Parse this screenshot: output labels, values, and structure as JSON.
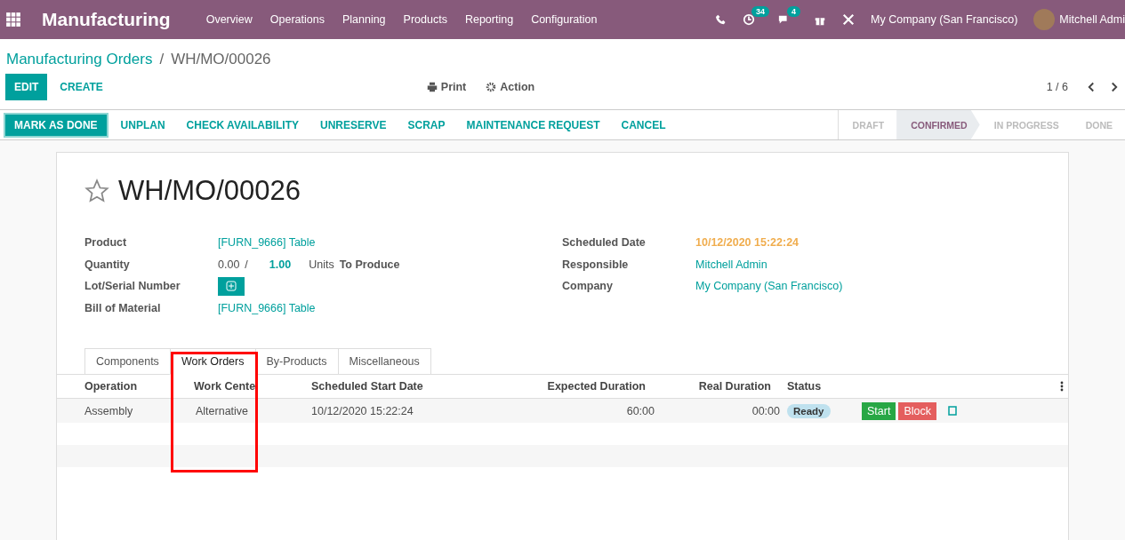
{
  "navbar": {
    "app_title": "Manufacturing",
    "menu": [
      "Overview",
      "Operations",
      "Planning",
      "Products",
      "Reporting",
      "Configuration"
    ],
    "activity_count": "34",
    "message_count": "4",
    "company": "My Company (San Francisco)",
    "user": "Mitchell Admi"
  },
  "breadcrumb": {
    "parent": "Manufacturing Orders",
    "separator": "/",
    "current": "WH/MO/00026"
  },
  "actions": {
    "edit": "EDIT",
    "create": "CREATE",
    "print": "Print",
    "action": "Action",
    "pager": "1 / 6"
  },
  "header_buttons": [
    {
      "label": "MARK AS DONE",
      "primary": true
    },
    {
      "label": "UNPLAN",
      "primary": false
    },
    {
      "label": "CHECK AVAILABILITY",
      "primary": false
    },
    {
      "label": "UNRESERVE",
      "primary": false
    },
    {
      "label": "SCRAP",
      "primary": false
    },
    {
      "label": "MAINTENANCE REQUEST",
      "primary": false
    },
    {
      "label": "CANCEL",
      "primary": false
    }
  ],
  "status_steps": [
    {
      "label": "DRAFT",
      "selected": false
    },
    {
      "label": "CONFIRMED",
      "selected": true
    },
    {
      "label": "IN PROGRESS",
      "selected": false
    },
    {
      "label": "DONE",
      "selected": false
    }
  ],
  "record": {
    "title": "WH/MO/00026",
    "starred": false
  },
  "left_fields": [
    {
      "kind": "link",
      "label": "Product",
      "value": "[FURN_9666] Table"
    },
    {
      "kind": "quantity",
      "label": "Quantity",
      "produced": "0.00",
      "slash": "/",
      "planned": "1.00",
      "uom": "Units",
      "suffix": "To Produce"
    },
    {
      "kind": "button",
      "label": "Lot/Serial Number"
    },
    {
      "kind": "link",
      "label": "Bill of Material",
      "value": "[FURN_9666] Table"
    }
  ],
  "right_fields": [
    {
      "kind": "date",
      "label": "Scheduled Date",
      "value": "10/12/2020 15:22:24"
    },
    {
      "kind": "link",
      "label": "Responsible",
      "value": "Mitchell Admin"
    },
    {
      "kind": "link",
      "label": "Company",
      "value": "My Company (San Francisco)"
    }
  ],
  "tabs": [
    {
      "label": "Components",
      "selected": false
    },
    {
      "label": "Work Orders",
      "selected": true
    },
    {
      "label": "By-Products",
      "selected": false
    },
    {
      "label": "Miscellaneous",
      "selected": false
    }
  ],
  "table": {
    "columns": [
      "Operation",
      "Work Cente",
      "Scheduled Start Date",
      "Expected Duration",
      "Real Duration",
      "Status"
    ],
    "rows": [
      {
        "operation": "Assembly",
        "work_center": "Alternative",
        "start": "10/12/2020 15:22:24",
        "expected": "60:00",
        "real": "00:00",
        "status": "Ready",
        "start_button": "Start",
        "block_button": "Block"
      }
    ]
  },
  "annotations": [
    {
      "kind": "highlight"
    }
  ]
}
